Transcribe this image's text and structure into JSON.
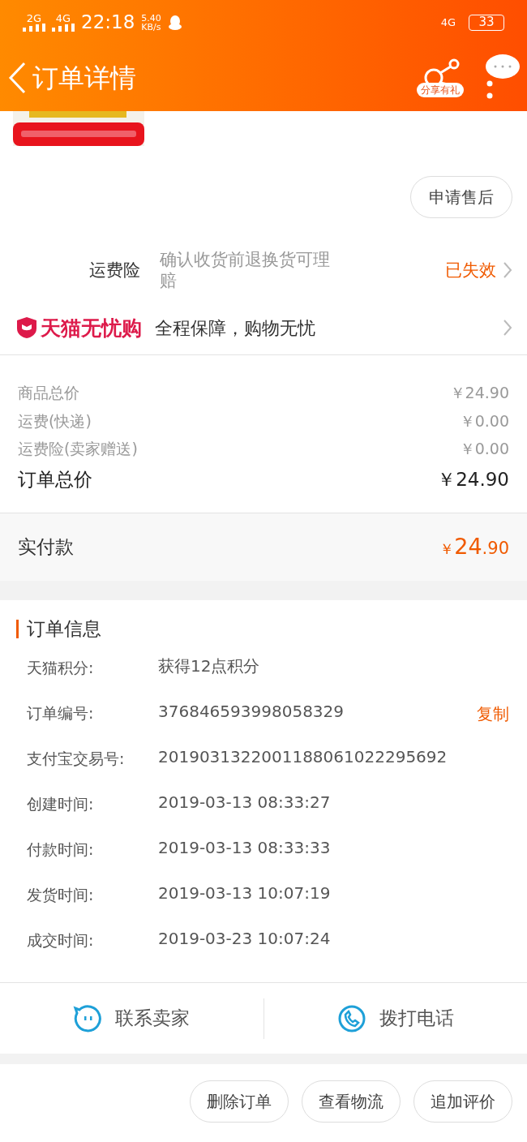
{
  "status_bar": {
    "network_1": "2G",
    "network_2": "4G",
    "time": "22:18",
    "speed": "5.40",
    "speed_unit": "KB/s",
    "network_3": "4G",
    "battery": "33"
  },
  "header": {
    "title": "订单详情",
    "share_label": "分享有礼"
  },
  "product": {
    "kind": "picture"
  },
  "after_sale_button": "申请售后",
  "insurance": {
    "label": "运费险",
    "description": "确认收货前退换货可理赔",
    "status": "已失效"
  },
  "guarantee": {
    "brand": "天猫无忧购",
    "slogan": "全程保障，购物无忧"
  },
  "price_rows": [
    {
      "label": "商品总价",
      "value": "￥24.90",
      "kind": "minor"
    },
    {
      "label": "运费(快递)",
      "value": "￥0.00",
      "kind": "minor"
    },
    {
      "label": "运费险(卖家赠送)",
      "value": "￥0.00",
      "kind": "minor"
    },
    {
      "label": "订单总价",
      "value": "￥24.90",
      "kind": "major"
    }
  ],
  "paid": {
    "label": "实付款",
    "currency": "￥",
    "integer": "24",
    "decimal": ".90"
  },
  "order_info": {
    "title": "订单信息",
    "rows": [
      {
        "label": "天猫积分:",
        "value": "获得12点积分"
      },
      {
        "label": "订单编号:",
        "value": "376846593998058329",
        "action": "复制"
      },
      {
        "label": "支付宝交易号:",
        "value": "2019031322001188061022295692"
      },
      {
        "label": "创建时间:",
        "value": "2019-03-13 08:33:27"
      },
      {
        "label": "付款时间:",
        "value": "2019-03-13 08:33:33"
      },
      {
        "label": "发货时间:",
        "value": "2019-03-13 10:07:19"
      },
      {
        "label": "成交时间:",
        "value": "2019-03-23 10:07:24"
      }
    ]
  },
  "contact": [
    {
      "label": "联系卖家",
      "kind": "chat"
    },
    {
      "label": "拨打电话",
      "kind": "phone"
    }
  ],
  "actions": [
    "删除订单",
    "查看物流",
    "追加评价"
  ]
}
